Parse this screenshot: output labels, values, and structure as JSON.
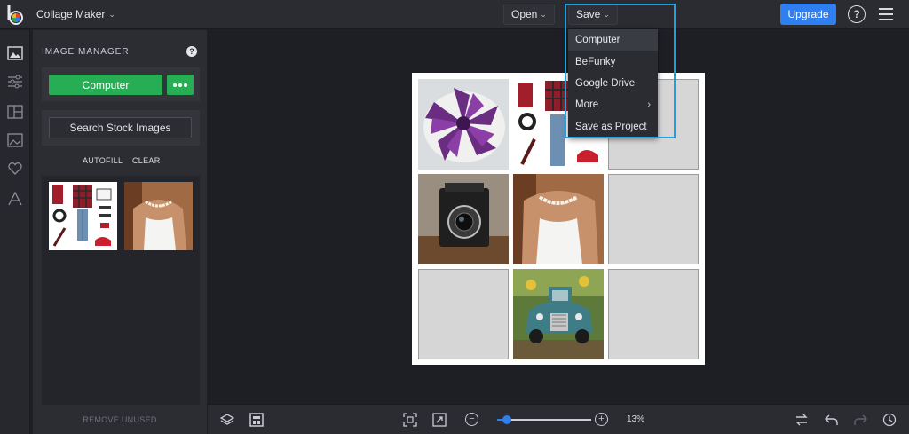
{
  "topbar": {
    "app_name": "Collage Maker",
    "open_label": "Open",
    "save_label": "Save",
    "upgrade_label": "Upgrade",
    "help_glyph": "?"
  },
  "save_menu": {
    "items": [
      {
        "label": "Computer",
        "has_submenu": false
      },
      {
        "label": "BeFunky",
        "has_submenu": false
      },
      {
        "label": "Google Drive",
        "has_submenu": false
      },
      {
        "label": "More",
        "has_submenu": true
      },
      {
        "label": "Save as Project",
        "has_submenu": false
      }
    ],
    "highlighted": "Computer"
  },
  "rail": {
    "icons": [
      "image-manager-icon",
      "adjust-sliders-icon",
      "layout-icon",
      "photo-icon",
      "heart-icon",
      "text-icon"
    ]
  },
  "panel": {
    "title": "IMAGE MANAGER",
    "computer_label": "Computer",
    "stock_label": "Search Stock Images",
    "autofill_label": "AUTOFILL",
    "clear_label": "CLEAR",
    "remove_unused_label": "REMOVE UNUSED",
    "thumbnails": [
      "fashion-flatlay",
      "necklace-portrait"
    ]
  },
  "collage": {
    "grid": [
      [
        "succulent-flower",
        "fashion-flatlay",
        "empty"
      ],
      [
        "vintage-camera",
        "necklace-portrait",
        "empty"
      ],
      [
        "empty",
        "vintage-truck",
        "empty"
      ]
    ]
  },
  "bottombar": {
    "zoom_percent": "13%",
    "zoom_level": 0.1
  },
  "colors": {
    "accent": "#2f7ff0",
    "green": "#27ad53",
    "highlight": "#1ba2e3"
  }
}
